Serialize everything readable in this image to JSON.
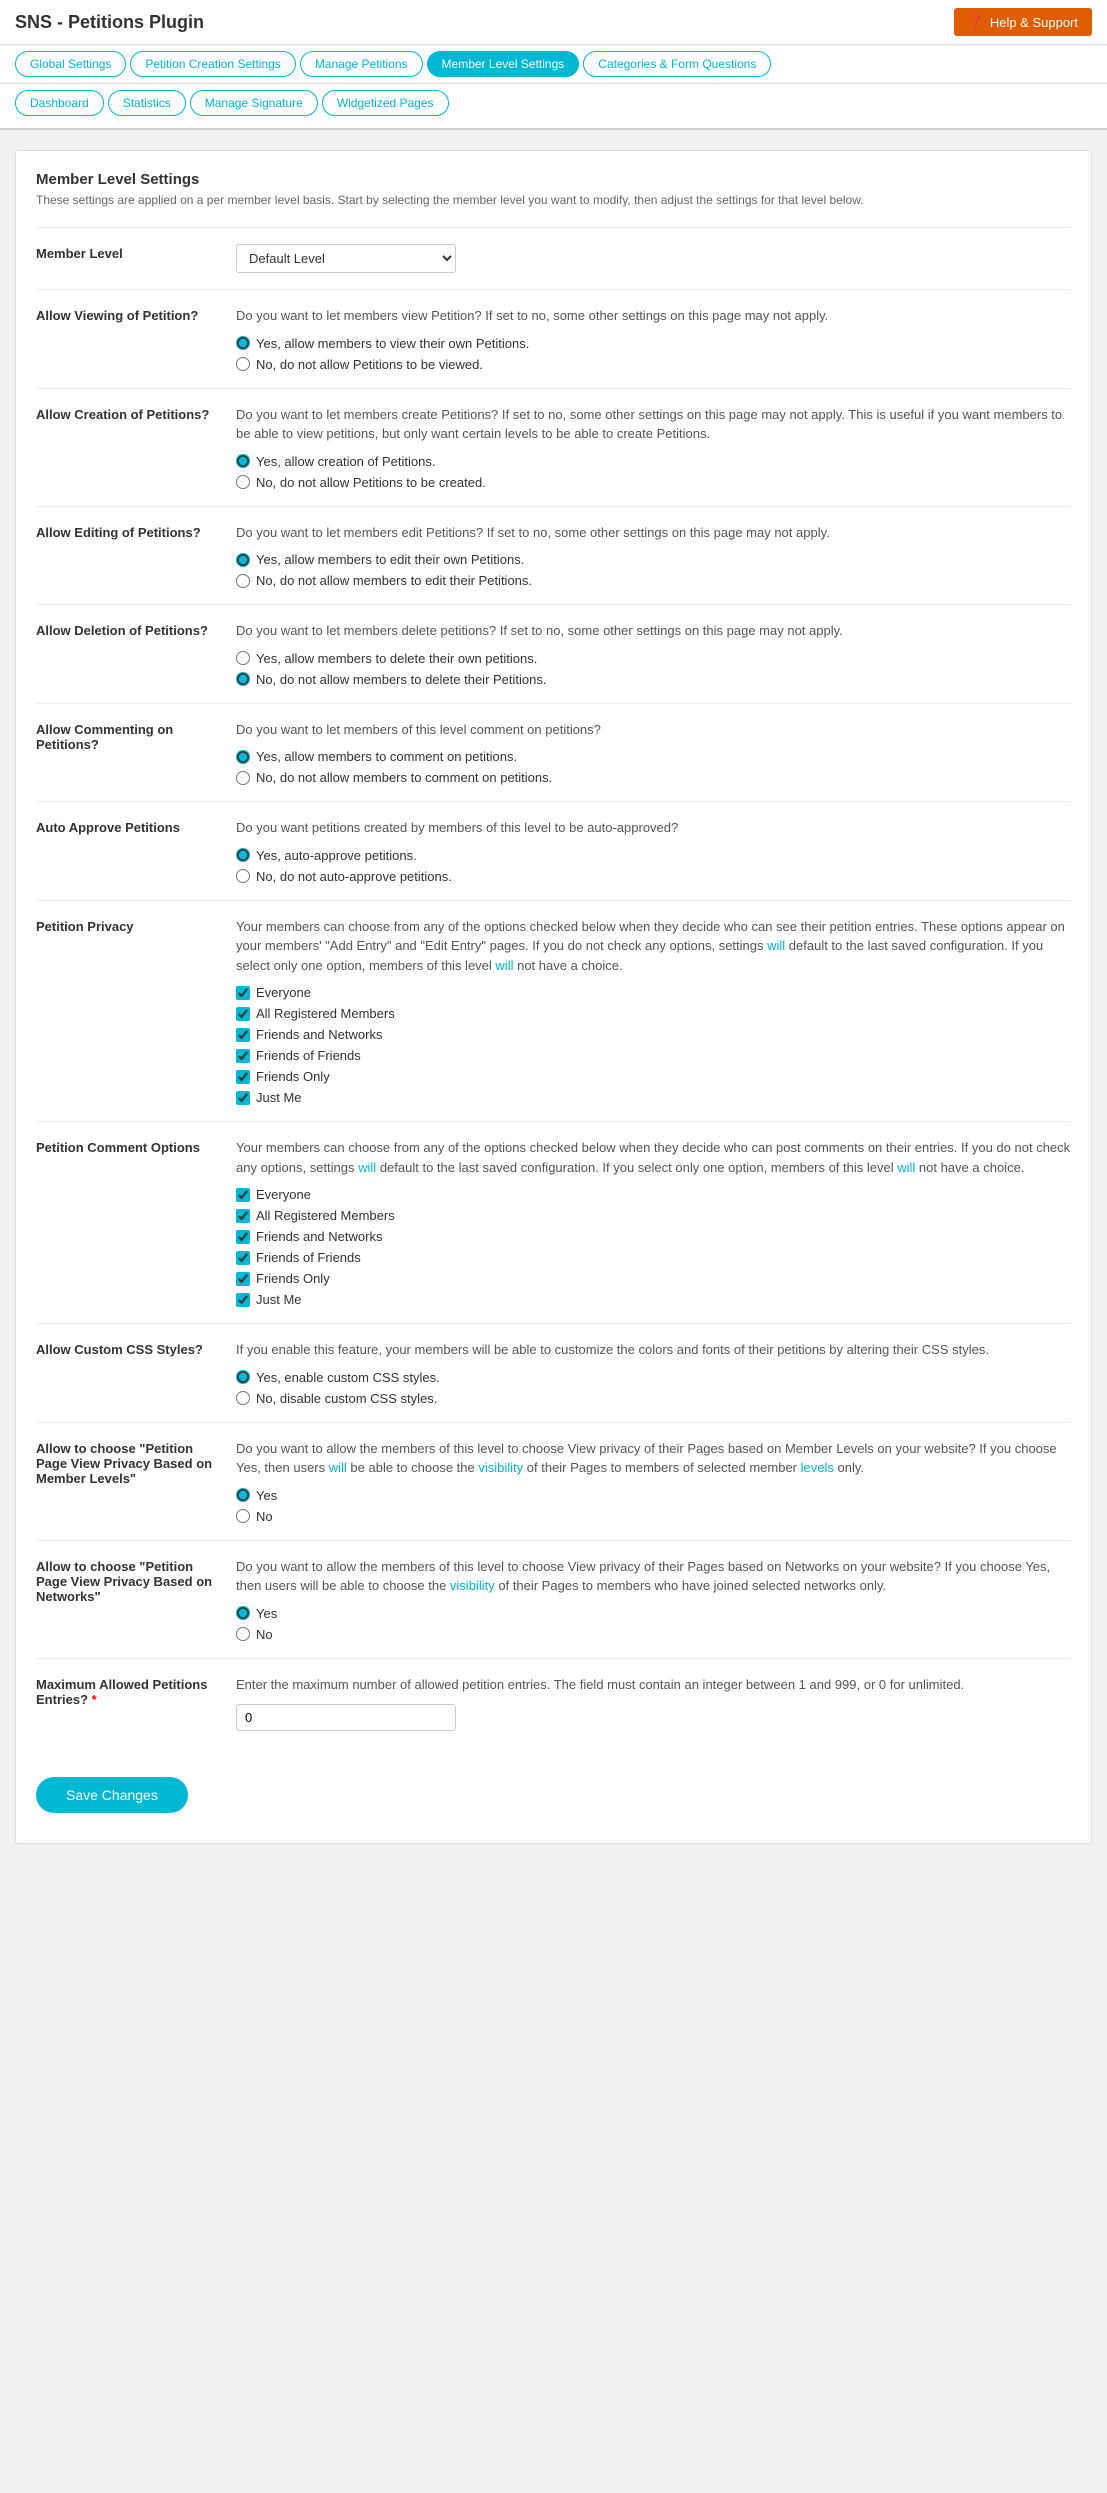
{
  "app": {
    "title": "SNS - Petitions Plugin"
  },
  "help_btn": {
    "label": "Help & Support",
    "icon": "?"
  },
  "nav_tabs_row1": [
    {
      "id": "global-settings",
      "label": "Global Settings",
      "active": false
    },
    {
      "id": "petition-creation-settings",
      "label": "Petition Creation Settings",
      "active": false
    },
    {
      "id": "manage-petitions",
      "label": "Manage Petitions",
      "active": false
    },
    {
      "id": "member-level-settings",
      "label": "Member Level Settings",
      "active": true
    },
    {
      "id": "categories-form-questions",
      "label": "Categories & Form Questions",
      "active": false
    }
  ],
  "nav_tabs_row2": [
    {
      "id": "dashboard",
      "label": "Dashboard",
      "active": false
    },
    {
      "id": "statistics",
      "label": "Statistics",
      "active": false
    },
    {
      "id": "manage-signature",
      "label": "Manage Signature",
      "active": false
    },
    {
      "id": "widgetized-pages",
      "label": "Widgetized Pages",
      "active": false
    }
  ],
  "page": {
    "title": "Member Level Settings",
    "description": "These settings are applied on a per member level basis. Start by selecting the member level you want to modify, then adjust the settings for that level below."
  },
  "member_level": {
    "label": "Member Level",
    "select_value": "Default Level",
    "options": [
      "Default Level"
    ]
  },
  "allow_viewing": {
    "label": "Allow Viewing of Petition?",
    "description": "Do you want to let members view Petition? If set to no, some other settings on this page may not apply.",
    "options": [
      {
        "id": "view-yes",
        "label": "Yes, allow members to view their own Petitions.",
        "checked": true
      },
      {
        "id": "view-no",
        "label": "No, do not allow Petitions to be viewed.",
        "checked": false
      }
    ]
  },
  "allow_creation": {
    "label": "Allow Creation of Petitions?",
    "description": "Do you want to let members create Petitions? If set to no, some other settings on this page may not apply. This is useful if you want members to be able to view petitions, but only want certain levels to be able to create Petitions.",
    "options": [
      {
        "id": "create-yes",
        "label": "Yes, allow creation of Petitions.",
        "checked": true
      },
      {
        "id": "create-no",
        "label": "No, do not allow Petitions to be created.",
        "checked": false
      }
    ]
  },
  "allow_editing": {
    "label": "Allow Editing of Petitions?",
    "description": "Do you want to let members edit Petitions? If set to no, some other settings on this page may not apply.",
    "options": [
      {
        "id": "edit-yes",
        "label": "Yes, allow members to edit their own Petitions.",
        "checked": true
      },
      {
        "id": "edit-no",
        "label": "No, do not allow members to edit their Petitions.",
        "checked": false
      }
    ]
  },
  "allow_deletion": {
    "label": "Allow Deletion of Petitions?",
    "description": "Do you want to let members delete petitions? If set to no, some other settings on this page may not apply.",
    "options": [
      {
        "id": "delete-yes",
        "label": "Yes, allow members to delete their own petitions.",
        "checked": false
      },
      {
        "id": "delete-no",
        "label": "No, do not allow members to delete their Petitions.",
        "checked": true
      }
    ]
  },
  "allow_commenting": {
    "label": "Allow Commenting on Petitions?",
    "description": "Do you want to let members of this level comment on petitions?",
    "options": [
      {
        "id": "comment-yes",
        "label": "Yes, allow members to comment on petitions.",
        "checked": true
      },
      {
        "id": "comment-no",
        "label": "No, do not allow members to comment on petitions.",
        "checked": false
      }
    ]
  },
  "auto_approve": {
    "label": "Auto Approve Petitions",
    "description": "Do you want petitions created by members of this level to be auto-approved?",
    "options": [
      {
        "id": "approve-yes",
        "label": "Yes, auto-approve petitions.",
        "checked": true
      },
      {
        "id": "approve-no",
        "label": "No, do not auto-approve petitions.",
        "checked": false
      }
    ]
  },
  "petition_privacy": {
    "label": "Petition Privacy",
    "description": "Your members can choose from any of the options checked below when they decide who can see their petition entries. These options appear on your members' \"Add Entry\" and \"Edit Entry\" pages. If you do not check any options, settings will default to the last saved configuration. If you select only one option, members of this level will not have a choice.",
    "options": [
      {
        "id": "privacy-everyone",
        "label": "Everyone",
        "checked": true
      },
      {
        "id": "privacy-all-registered",
        "label": "All Registered Members",
        "checked": true
      },
      {
        "id": "privacy-friends-networks",
        "label": "Friends and Networks",
        "checked": true
      },
      {
        "id": "privacy-friends-of-friends",
        "label": "Friends of Friends",
        "checked": true
      },
      {
        "id": "privacy-friends-only",
        "label": "Friends Only",
        "checked": true
      },
      {
        "id": "privacy-just-me",
        "label": "Just Me",
        "checked": true
      }
    ]
  },
  "petition_comment_options": {
    "label": "Petition Comment Options",
    "description": "Your members can choose from any of the options checked below when they decide who can post comments on their entries. If you do not check any options, settings will default to the last saved configuration. If you select only one option, members of this level will not have a choice.",
    "options": [
      {
        "id": "comment-opt-everyone",
        "label": "Everyone",
        "checked": true
      },
      {
        "id": "comment-opt-all-registered",
        "label": "All Registered Members",
        "checked": true
      },
      {
        "id": "comment-opt-friends-networks",
        "label": "Friends and Networks",
        "checked": true
      },
      {
        "id": "comment-opt-friends-of-friends",
        "label": "Friends of Friends",
        "checked": true
      },
      {
        "id": "comment-opt-friends-only",
        "label": "Friends Only",
        "checked": true
      },
      {
        "id": "comment-opt-just-me",
        "label": "Just Me",
        "checked": true
      }
    ]
  },
  "allow_custom_css": {
    "label": "Allow Custom CSS Styles?",
    "description": "If you enable this feature, your members will be able to customize the colors and fonts of their petitions by altering their CSS styles.",
    "options": [
      {
        "id": "css-yes",
        "label": "Yes, enable custom CSS styles.",
        "checked": true
      },
      {
        "id": "css-no",
        "label": "No, disable custom CSS styles.",
        "checked": false
      }
    ]
  },
  "allow_page_view_privacy_member": {
    "label": "Allow to choose \"Petition Page View Privacy Based on Member Levels\"",
    "description": "Do you want to allow the members of this level to choose View privacy of their Pages based on Member Levels on your website? If you choose Yes, then users will be able to choose the visibility of their Pages to members of selected member levels only.",
    "options": [
      {
        "id": "member-privacy-yes",
        "label": "Yes",
        "checked": true
      },
      {
        "id": "member-privacy-no",
        "label": "No",
        "checked": false
      }
    ]
  },
  "allow_page_view_privacy_network": {
    "label": "Allow to choose \"Petition Page View Privacy Based on Networks\"",
    "description": "Do you want to allow the members of this level to choose View privacy of their Pages based on Networks on your website? If you choose Yes, then users will be able to choose the visibility of their Pages to members who have joined selected networks only.",
    "options": [
      {
        "id": "network-privacy-yes",
        "label": "Yes",
        "checked": true
      },
      {
        "id": "network-privacy-no",
        "label": "No",
        "checked": false
      }
    ]
  },
  "max_petition_entries": {
    "label": "Maximum Allowed Petitions Entries?",
    "required": true,
    "description": "Enter the maximum number of allowed petition entries. The field must contain an integer between 1 and 999, or 0 for unlimited.",
    "value": "0",
    "placeholder": "0"
  },
  "save_btn": {
    "label": "Save Changes"
  }
}
